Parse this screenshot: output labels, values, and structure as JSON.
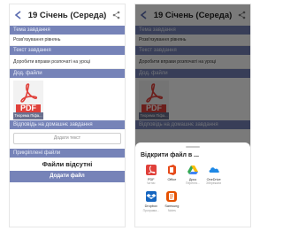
{
  "header": {
    "title": "19 Січень (Середа)"
  },
  "sections": {
    "topic_label": "Тема завдання",
    "topic_value": "Розв'язування рівнянь",
    "text_label": "Текст завдання",
    "text_value": "Доробити вправи розпочаті на уроці",
    "files_label": "Дод. файли",
    "attachment": {
      "icon_text": "PDF",
      "name": "Теорема Піфа..."
    },
    "answer_label": "Відповідь на домашнє завдання",
    "answer_placeholder": "Додати текст",
    "attached_label": "Прикріплені файли",
    "no_files": "Файли відсутні",
    "add_files_button": "Додати файл"
  },
  "share_sheet": {
    "title": "Відкрити файл в ...",
    "apps": [
      {
        "name": "PDF",
        "sub": "Читач",
        "icon": "pdf-reader-icon",
        "color": "#e0403a"
      },
      {
        "name": "Office",
        "sub": "",
        "icon": "office-icon",
        "color": "#e64a19"
      },
      {
        "name": "Диск",
        "sub": "Перегля...",
        "icon": "drive-icon",
        "color": "#34a853"
      },
      {
        "name": "OneDrive",
        "sub": "Збережати",
        "icon": "onedrive-icon",
        "color": "#1e88e5"
      },
      {
        "name": "Dropbox",
        "sub": "Програма...",
        "icon": "dropbox-icon",
        "color": "#1565c0"
      },
      {
        "name": "Samsung",
        "sub": "Notes",
        "icon": "samsung-notes-icon",
        "color": "#e65100"
      }
    ]
  },
  "colors": {
    "section_header": "#7683b8",
    "pdf_red": "#e0403a",
    "accent": "#5a6bb0"
  }
}
